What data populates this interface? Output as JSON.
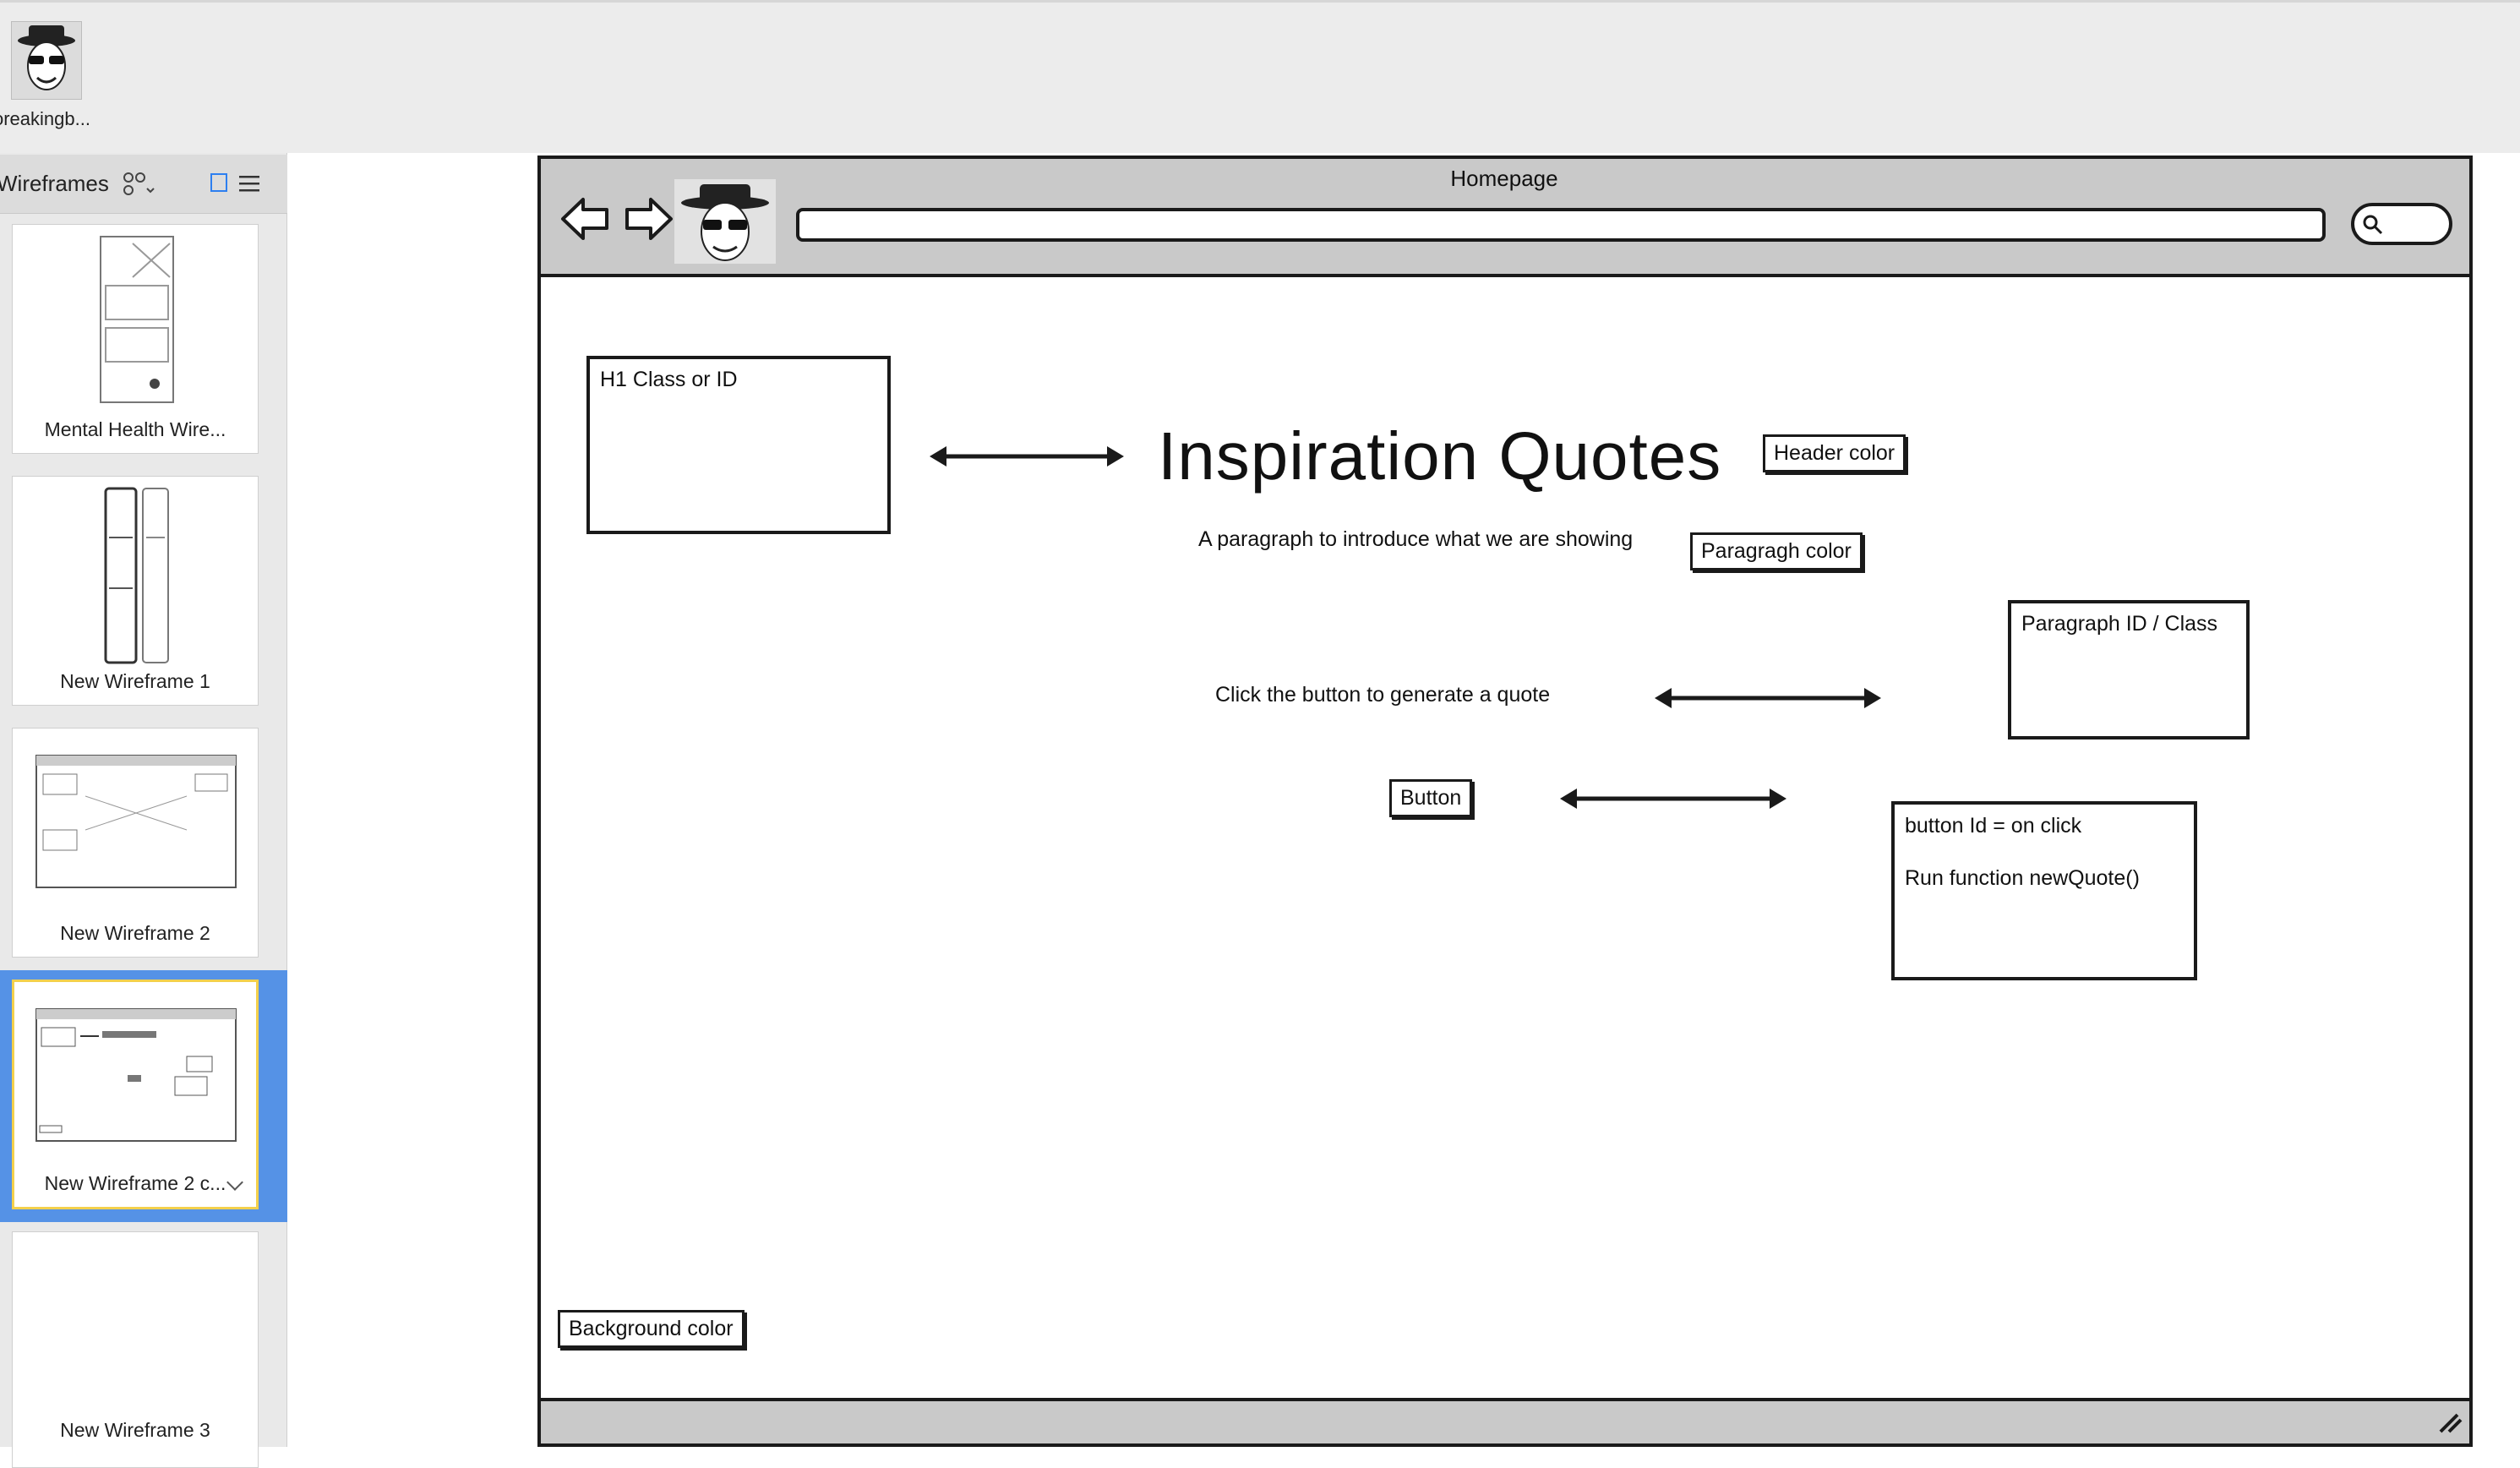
{
  "assets": {
    "item_label": "oreakingb..."
  },
  "sidebar": {
    "title": "Wireframes",
    "cards": [
      {
        "label": "Mental Health Wire..."
      },
      {
        "label": "New Wireframe 1"
      },
      {
        "label": "New Wireframe 2"
      },
      {
        "label": "New Wireframe 2 c...",
        "selected": true
      },
      {
        "label": "New Wireframe 3"
      }
    ]
  },
  "wireframe": {
    "page_title": "Homepage",
    "h1_box_label": "H1 Class or ID",
    "heading": "Inspiration Quotes",
    "header_color_tag": "Header color",
    "paragraph_text": "A paragraph to introduce what we are showing",
    "paragraph_color_tag": "Paragragh color",
    "paragraph_id_box_label": "Paragraph ID / Class",
    "click_text": "Click the button to generate a quote",
    "button_label": "Button",
    "button_box_line1": "button Id = on click",
    "button_box_line2": "Run function newQuote()",
    "background_color_tag": "Background color"
  },
  "colors": {
    "selection": "#5592e6",
    "selected_border": "#f3d04c",
    "chrome": "#c9c9c9"
  }
}
